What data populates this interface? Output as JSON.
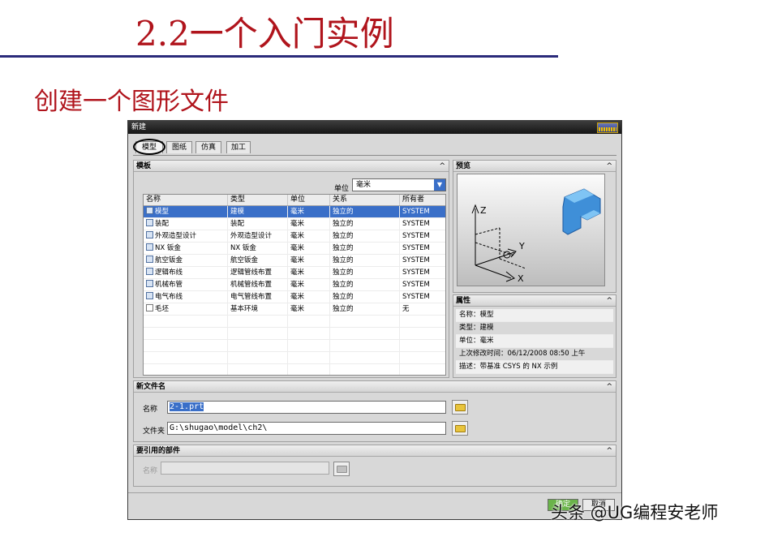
{
  "slide": {
    "title": "2.2一个入门实例",
    "subtitle": "创建一个图形文件",
    "watermark": "头条 @UG编程安老师"
  },
  "dialog": {
    "title": "新建",
    "tabs": [
      {
        "label": "模型",
        "active": true
      },
      {
        "label": "图纸",
        "active": false
      },
      {
        "label": "仿真",
        "active": false
      },
      {
        "label": "加工",
        "active": false
      }
    ],
    "template": {
      "header": "模板",
      "unit_label": "单位",
      "unit_value": "毫米",
      "columns": [
        "名称",
        "类型",
        "单位",
        "关系",
        "所有者"
      ],
      "rows": [
        {
          "name": "模型",
          "type": "建模",
          "unit": "毫米",
          "relation": "独立的",
          "owner": "SYSTEM",
          "selected": true
        },
        {
          "name": "装配",
          "type": "装配",
          "unit": "毫米",
          "relation": "独立的",
          "owner": "SYSTEM"
        },
        {
          "name": "外观造型设计",
          "type": "外观造型设计",
          "unit": "毫米",
          "relation": "独立的",
          "owner": "SYSTEM"
        },
        {
          "name": "NX 钣金",
          "type": "NX 钣金",
          "unit": "毫米",
          "relation": "独立的",
          "owner": "SYSTEM"
        },
        {
          "name": "航空钣金",
          "type": "航空钣金",
          "unit": "毫米",
          "relation": "独立的",
          "owner": "SYSTEM"
        },
        {
          "name": "逻辑布线",
          "type": "逻辑管线布置",
          "unit": "毫米",
          "relation": "独立的",
          "owner": "SYSTEM"
        },
        {
          "name": "机械布管",
          "type": "机械管线布置",
          "unit": "毫米",
          "relation": "独立的",
          "owner": "SYSTEM"
        },
        {
          "name": "电气布线",
          "type": "电气管线布置",
          "unit": "毫米",
          "relation": "独立的",
          "owner": "SYSTEM"
        },
        {
          "name": "毛坯",
          "type": "基本环境",
          "unit": "毫米",
          "relation": "独立的",
          "owner": "无"
        }
      ]
    },
    "preview": {
      "header": "预览",
      "axis_z": "Z",
      "axis_y": "Y",
      "axis_x": "X"
    },
    "properties": {
      "header": "属性",
      "lines": [
        "名称：模型",
        "类型：建模",
        "单位：毫米",
        "上次修改时间：06/12/2008 08:50 上午",
        "描述：带基准 CSYS 的 NX 示例"
      ]
    },
    "new_file": {
      "header": "新文件名",
      "name_label": "名称",
      "name_value": "2-1.prt",
      "folder_label": "文件夹",
      "folder_value": "G:\\shugao\\model\\ch2\\"
    },
    "referenced": {
      "header": "要引用的部件",
      "name_label": "名称",
      "name_value": ""
    },
    "buttons": {
      "ok": "确定",
      "cancel": "取消"
    },
    "colors": {
      "selection": "#3a6fc8",
      "title_red": "#b0141c",
      "rule_blue": "#2a2a7a"
    }
  }
}
